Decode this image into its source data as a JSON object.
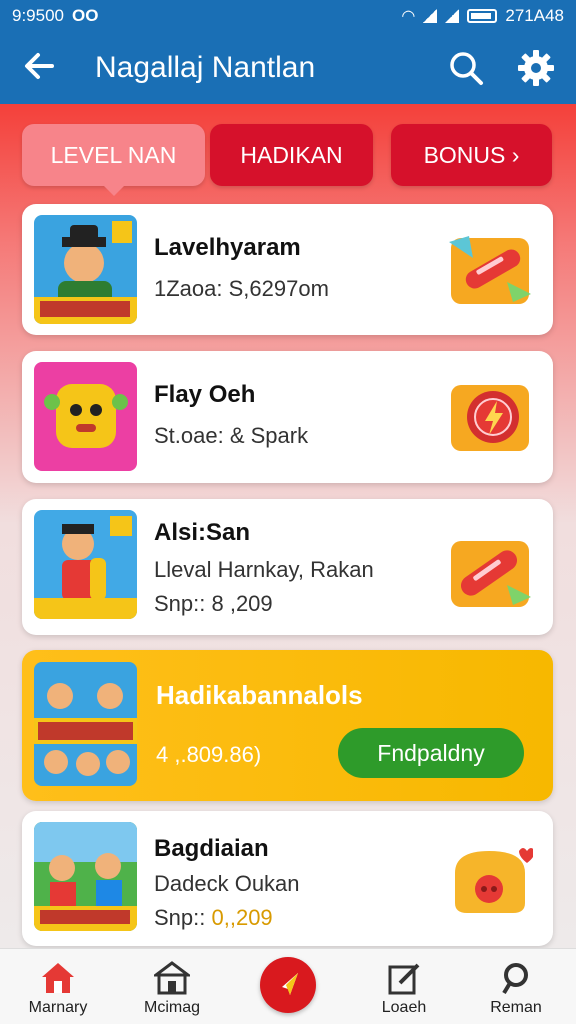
{
  "status_bar": {
    "time": "9:9500",
    "indicator": "OO",
    "right_text": "271A48"
  },
  "app_bar": {
    "title": "Nagallaj Nantlan"
  },
  "tabs": [
    {
      "label": "LEVEL NAN",
      "active": true
    },
    {
      "label": "HADIKAN",
      "active": false
    },
    {
      "label": "BONUS ›",
      "active": false
    }
  ],
  "cards": [
    {
      "title": "Lavelhyaram",
      "line1": "1Zaoa: S,6297om",
      "reward_icon": "candy-reward-icon"
    },
    {
      "title": "Flay Oeh",
      "line1": "St.oae: & Spark",
      "reward_icon": "lightning-badge-icon"
    },
    {
      "title": "Alsi:San",
      "line1": "Lleval Harnkay, Rakan",
      "line2": "Snp:: 8 ,209",
      "reward_icon": "candy-reward-icon"
    },
    {
      "title": "Hadikabannalols",
      "line1": "4 ,.809.86)",
      "button": "Fndpaldny",
      "featured": true
    },
    {
      "title": "Bagdiaian",
      "line1": "Dadeck Oukan",
      "line2_prefix": "Snp::",
      "line2_value": "0,,209",
      "reward_icon": "piggy-bank-icon"
    }
  ],
  "bottom_nav": [
    {
      "label": "Marnary",
      "icon": "home-icon"
    },
    {
      "label": "Mcimag",
      "icon": "shop-icon"
    },
    {
      "label": "",
      "icon": "compass-icon"
    },
    {
      "label": "Loaeh",
      "icon": "edit-icon"
    },
    {
      "label": "Reman",
      "icon": "search-person-icon"
    }
  ],
  "colors": {
    "primary": "#1a6fb5",
    "accent_red": "#d6112b",
    "tab_active": "#f7848a",
    "featured": "#ffbf1a",
    "cta_green": "#2e9b2a"
  }
}
